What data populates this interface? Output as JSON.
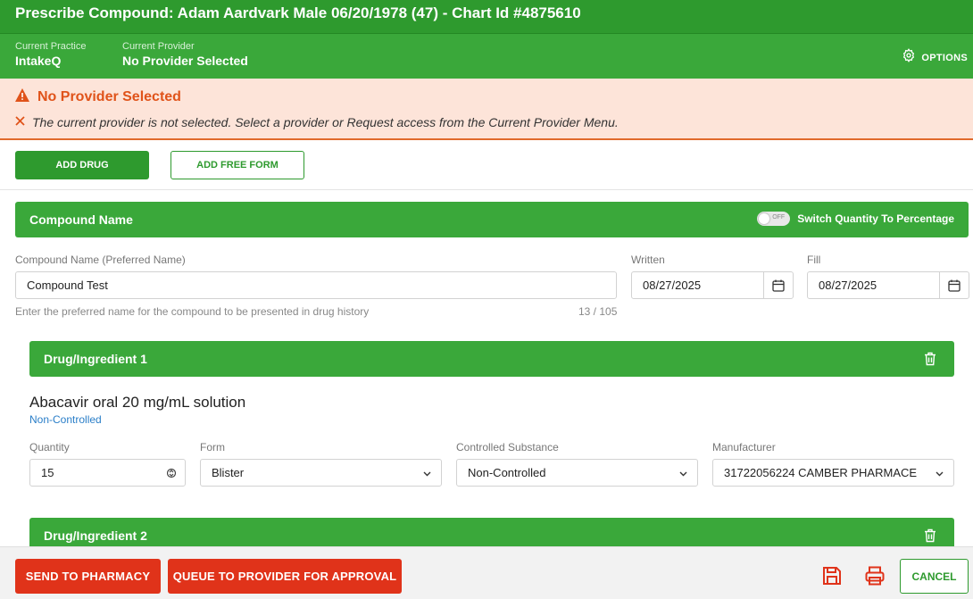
{
  "window": {
    "title": "Prescribe Compound: Adam Aardvark Male 06/20/1978 (47) - Chart Id #4875610"
  },
  "context": {
    "practice_label": "Current Practice",
    "practice_value": "IntakeQ",
    "provider_label": "Current Provider",
    "provider_value": "No Provider Selected",
    "options_label": "OPTIONS",
    "options_icon": "gear-icon"
  },
  "alert": {
    "title": "No Provider Selected",
    "message": "The current provider is not selected. Select a provider or Request access from the Current Provider Menu.",
    "title_color": "#e0531a",
    "background": "#fde4d9"
  },
  "actions": {
    "add_drug": "ADD DRUG",
    "add_free_form": "ADD FREE FORM"
  },
  "compound": {
    "section_title": "Compound Name",
    "toggle_state": "OFF",
    "toggle_label": "Switch Quantity To Percentage",
    "name_label": "Compound Name (Preferred Name)",
    "name_value": "Compound Test",
    "name_hint": "Enter the preferred name for the compound to be presented in drug history",
    "name_counter": "13 / 105",
    "written_label": "Written",
    "written_value": "08/27/2025",
    "fill_label": "Fill",
    "fill_value": "08/27/2025"
  },
  "ingredients": [
    {
      "title": "Drug/Ingredient 1",
      "drug_name": "Abacavir oral 20 mg/mL solution",
      "control_status": "Non-Controlled",
      "quantity_label": "Quantity",
      "quantity_value": "15",
      "form_label": "Form",
      "form_value": "Blister",
      "controlled_label": "Controlled Substance",
      "controlled_value": "Non-Controlled",
      "manufacturer_label": "Manufacturer",
      "manufacturer_value": "31722056224 CAMBER PHARMACE"
    },
    {
      "title": "Drug/Ingredient 2"
    }
  ],
  "footer": {
    "send_to_pharmacy": "SEND TO PHARMACY",
    "queue_for_approval": "QUEUE TO PROVIDER FOR APPROVAL",
    "save_icon": "save-icon",
    "print_icon": "print-icon",
    "cancel": "CANCEL"
  },
  "colors": {
    "primary_green": "#2e9a2e",
    "section_green": "#3aa83a",
    "danger_red": "#e0331a",
    "link_blue": "#2a7ec8"
  }
}
